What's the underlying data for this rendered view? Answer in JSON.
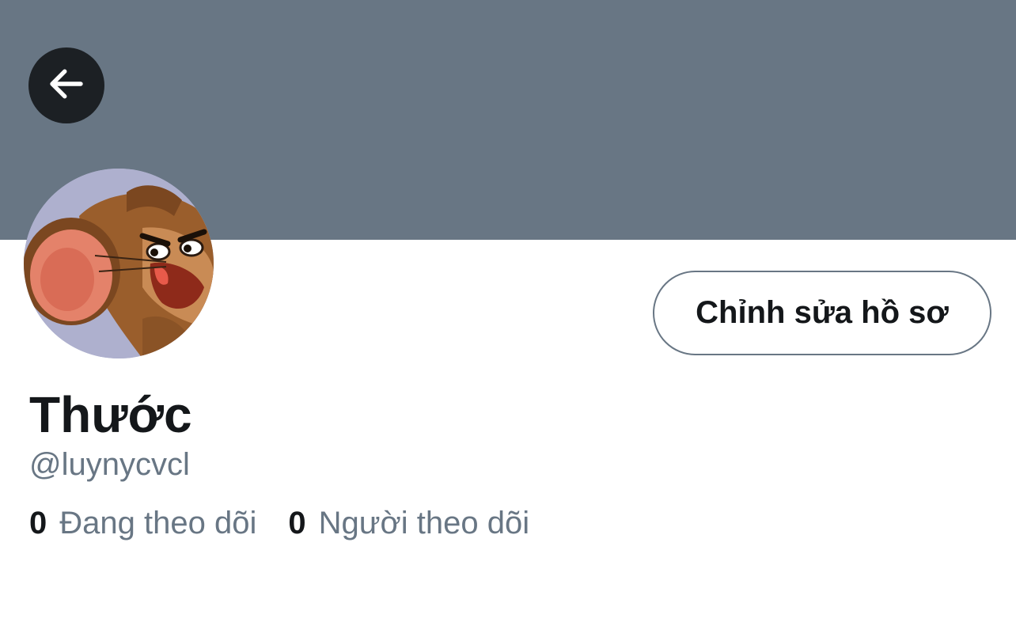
{
  "banner": {
    "color": "#687684"
  },
  "nav": {
    "back_icon": "arrow-left-icon"
  },
  "profile": {
    "avatar_desc": "cartoon-mouse-avatar",
    "edit_button_label": "Chỉnh sửa hồ sơ",
    "display_name": "Thước",
    "handle": "@luynycvcl"
  },
  "stats": {
    "following_count": "0",
    "following_label": "Đang theo dõi",
    "followers_count": "0",
    "followers_label": "Người theo dõi"
  },
  "colors": {
    "text_primary": "#14171a",
    "text_secondary": "#687684",
    "back_button_bg": "#1c2024"
  }
}
